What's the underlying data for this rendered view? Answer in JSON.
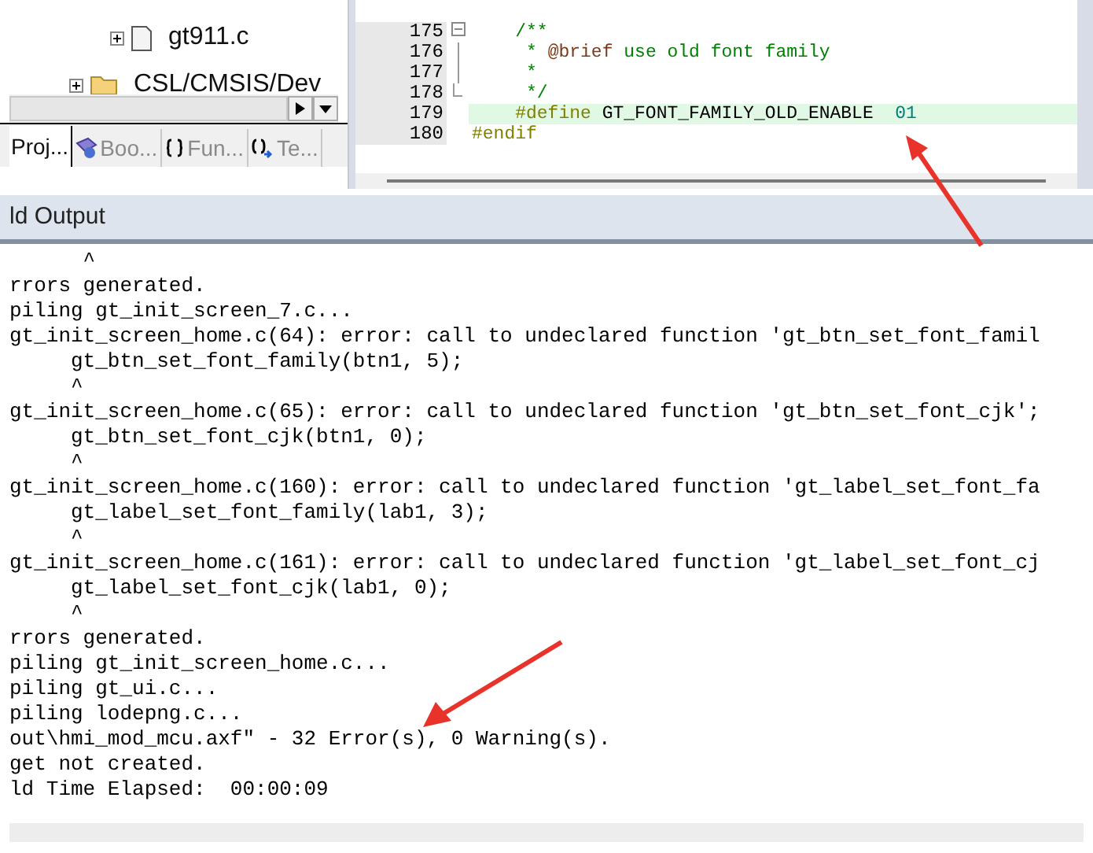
{
  "project_tree": {
    "items": [
      {
        "label": "gt911.c",
        "kind": "file",
        "expanded": false
      },
      {
        "label": "CSL/CMSIS/Dev",
        "kind": "folder",
        "expanded": false
      }
    ]
  },
  "panel_tabs": [
    {
      "label": "Proj...",
      "kind": "project",
      "selected": true
    },
    {
      "label": "Boo...",
      "kind": "books",
      "selected": false
    },
    {
      "label": "Fun...",
      "kind": "functions",
      "selected": false
    },
    {
      "label": "Te...",
      "kind": "templates",
      "selected": false
    }
  ],
  "editor": {
    "lines": [
      {
        "number": "175",
        "kind": "fold_start",
        "highlighted": false,
        "tokens": [
          {
            "text": "    /**",
            "kind": "comment"
          }
        ]
      },
      {
        "number": "176",
        "kind": "fold_body",
        "highlighted": false,
        "tokens": [
          {
            "text": "     * ",
            "kind": "comment"
          },
          {
            "text": "@brief",
            "kind": "doctag"
          },
          {
            "text": " use old font family",
            "kind": "comment"
          }
        ]
      },
      {
        "number": "177",
        "kind": "fold_body",
        "highlighted": false,
        "tokens": [
          {
            "text": "     *",
            "kind": "comment"
          }
        ]
      },
      {
        "number": "178",
        "kind": "fold_end",
        "highlighted": false,
        "tokens": [
          {
            "text": "     */",
            "kind": "comment"
          }
        ]
      },
      {
        "number": "179",
        "kind": "plain",
        "highlighted": true,
        "tokens": [
          {
            "text": "    #define",
            "kind": "preprocessor"
          },
          {
            "text": " GT_FONT_FAMILY_OLD_ENABLE  ",
            "kind": "plain"
          },
          {
            "text": "01",
            "kind": "number"
          }
        ]
      },
      {
        "number": "180",
        "kind": "plain",
        "highlighted": false,
        "tokens": [
          {
            "text": "#endif",
            "kind": "preprocessor"
          }
        ]
      }
    ]
  },
  "build_output": {
    "title": "ld Output",
    "lines": [
      "      ^",
      "rrors generated.",
      "piling gt_init_screen_7.c...",
      "gt_init_screen_home.c(64): error: call to undeclared function 'gt_btn_set_font_famil",
      "     gt_btn_set_font_family(btn1, 5);",
      "     ^",
      "gt_init_screen_home.c(65): error: call to undeclared function 'gt_btn_set_font_cjk';",
      "     gt_btn_set_font_cjk(btn1, 0);",
      "     ^",
      "gt_init_screen_home.c(160): error: call to undeclared function 'gt_label_set_font_fa",
      "     gt_label_set_font_family(lab1, 3);",
      "     ^",
      "gt_init_screen_home.c(161): error: call to undeclared function 'gt_label_set_font_cj",
      "     gt_label_set_font_cjk(lab1, 0);",
      "     ^",
      "rrors generated.",
      "piling gt_init_screen_home.c...",
      "piling gt_ui.c...",
      "piling lodepng.c...",
      "out\\hmi_mod_mcu.axf\" - 32 Error(s), 0 Warning(s).",
      "get not created.",
      "ld Time Elapsed:  00:00:09"
    ]
  }
}
